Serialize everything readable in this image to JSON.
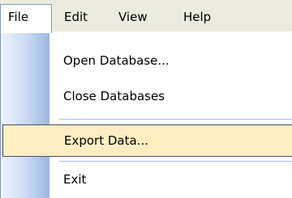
{
  "menubar": {
    "menus": [
      {
        "label": "File"
      },
      {
        "label": "Edit"
      },
      {
        "label": "View"
      },
      {
        "label": "Help"
      }
    ],
    "active_menu": "File"
  },
  "dropdown": {
    "items": [
      {
        "label": "Open Database..."
      },
      {
        "label": "Close Databases"
      },
      {
        "label": "Export Data...",
        "highlighted": true
      },
      {
        "label": "Exit"
      }
    ]
  },
  "colors": {
    "menubar_bg": "#ecebdf",
    "highlight_bg": "#ffeec2",
    "highlight_border": "#4b4b6f",
    "gutter_light": "#edf3fb",
    "gutter_dark": "#9bb7e2",
    "separator": "#a6bfe5",
    "menu_border": "#7f9db9"
  }
}
